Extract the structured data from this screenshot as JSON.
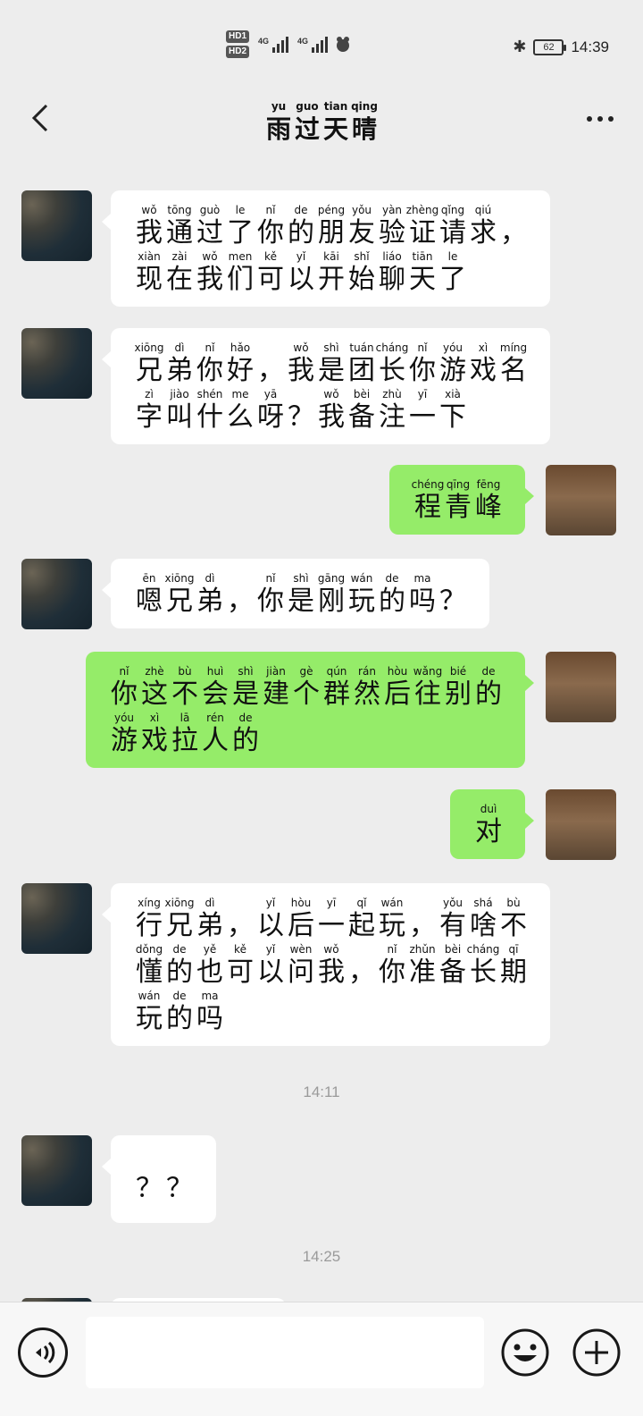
{
  "status_bar": {
    "hd1": "HD1",
    "hd2": "HD2",
    "net1": "4G",
    "net2": "4G",
    "battery": "62",
    "time": "14:39"
  },
  "header": {
    "title_chars": [
      {
        "py": "yu",
        "hz": "雨"
      },
      {
        "py": "guo",
        "hz": "过"
      },
      {
        "py": "tian",
        "hz": "天"
      },
      {
        "py": "qing",
        "hz": "晴"
      }
    ],
    "back_icon": "chevron-left-icon",
    "more_icon": "more-dots-icon"
  },
  "messages": [
    {
      "side": "left",
      "lines": [
        [
          [
            "wǒ",
            "我"
          ],
          [
            "tōng",
            "通"
          ],
          [
            "guò",
            "过"
          ],
          [
            "le",
            "了"
          ],
          [
            "nǐ",
            "你"
          ],
          [
            "de",
            "的"
          ],
          [
            "péng",
            "朋"
          ],
          [
            "yǒu",
            "友"
          ],
          [
            "yàn",
            "验"
          ],
          [
            "zhèng",
            "证"
          ],
          [
            "qǐng",
            "请"
          ],
          [
            "qiú",
            "求"
          ],
          [
            "",
            "，"
          ]
        ],
        [
          [
            "xiàn",
            "现"
          ],
          [
            "zài",
            "在"
          ],
          [
            "wǒ",
            "我"
          ],
          [
            "men",
            "们"
          ],
          [
            "kě",
            "可"
          ],
          [
            "yǐ",
            "以"
          ],
          [
            "kāi",
            "开"
          ],
          [
            "shǐ",
            "始"
          ],
          [
            "liáo",
            "聊"
          ],
          [
            "tiān",
            "天"
          ],
          [
            "le",
            "了"
          ]
        ]
      ]
    },
    {
      "side": "left",
      "lines": [
        [
          [
            "xiōng",
            "兄"
          ],
          [
            "dì",
            "弟"
          ],
          [
            "nǐ",
            "你"
          ],
          [
            "hǎo",
            "好"
          ],
          [
            "",
            "，"
          ],
          [
            "wǒ",
            "我"
          ],
          [
            "shì",
            "是"
          ],
          [
            "tuán",
            "团"
          ],
          [
            "cháng",
            "长"
          ],
          [
            "nǐ",
            "你"
          ],
          [
            "yóu",
            "游"
          ],
          [
            "xì",
            "戏"
          ],
          [
            "míng",
            "名"
          ]
        ],
        [
          [
            "zì",
            "字"
          ],
          [
            "jiào",
            "叫"
          ],
          [
            "shén",
            "什"
          ],
          [
            "me",
            "么"
          ],
          [
            "yā",
            "呀"
          ],
          [
            "",
            "？"
          ],
          [
            "wǒ",
            "我"
          ],
          [
            "bèi",
            "备"
          ],
          [
            "zhù",
            "注"
          ],
          [
            "yī",
            "一"
          ],
          [
            "xià",
            "下"
          ]
        ]
      ]
    },
    {
      "side": "right",
      "lines": [
        [
          [
            "chéng",
            "程"
          ],
          [
            "qīng",
            "青"
          ],
          [
            "fēng",
            "峰"
          ]
        ]
      ]
    },
    {
      "side": "left",
      "lines": [
        [
          [
            "ēn",
            "嗯"
          ],
          [
            "xiōng",
            "兄"
          ],
          [
            "dì",
            "弟"
          ],
          [
            "",
            "，"
          ],
          [
            "nǐ",
            "你"
          ],
          [
            "shì",
            "是"
          ],
          [
            "gāng",
            "刚"
          ],
          [
            "wán",
            "玩"
          ],
          [
            "de",
            "的"
          ],
          [
            "ma",
            "吗"
          ],
          [
            "",
            "？"
          ]
        ]
      ]
    },
    {
      "side": "right",
      "lines": [
        [
          [
            "nǐ",
            "你"
          ],
          [
            "zhè",
            "这"
          ],
          [
            "bù",
            "不"
          ],
          [
            "huì",
            "会"
          ],
          [
            "shì",
            "是"
          ],
          [
            "jiàn",
            "建"
          ],
          [
            "gè",
            "个"
          ],
          [
            "qún",
            "群"
          ],
          [
            "rán",
            "然"
          ],
          [
            "hòu",
            "后"
          ],
          [
            "wǎng",
            "往"
          ],
          [
            "bié",
            "别"
          ],
          [
            "de",
            "的"
          ]
        ],
        [
          [
            "yóu",
            "游"
          ],
          [
            "xì",
            "戏"
          ],
          [
            "lā",
            "拉"
          ],
          [
            "rén",
            "人"
          ],
          [
            "de",
            "的"
          ]
        ]
      ]
    },
    {
      "side": "right",
      "lines": [
        [
          [
            "duì",
            "对"
          ]
        ]
      ]
    },
    {
      "side": "left",
      "lines": [
        [
          [
            "xíng",
            "行"
          ],
          [
            "xiōng",
            "兄"
          ],
          [
            "dì",
            "弟"
          ],
          [
            "",
            "，"
          ],
          [
            "yǐ",
            "以"
          ],
          [
            "hòu",
            "后"
          ],
          [
            "yī",
            "一"
          ],
          [
            "qǐ",
            "起"
          ],
          [
            "wán",
            "玩"
          ],
          [
            "",
            "，"
          ],
          [
            "yǒu",
            "有"
          ],
          [
            "shá",
            "啥"
          ],
          [
            "bù",
            "不"
          ]
        ],
        [
          [
            "dǒng",
            "懂"
          ],
          [
            "de",
            "的"
          ],
          [
            "yě",
            "也"
          ],
          [
            "kě",
            "可"
          ],
          [
            "yǐ",
            "以"
          ],
          [
            "wèn",
            "问"
          ],
          [
            "wǒ",
            "我"
          ],
          [
            "",
            "，"
          ],
          [
            "nǐ",
            "你"
          ],
          [
            "zhǔn",
            "准"
          ],
          [
            "bèi",
            "备"
          ],
          [
            "cháng",
            "长"
          ],
          [
            "qī",
            "期"
          ]
        ],
        [
          [
            "wán",
            "玩"
          ],
          [
            "de",
            "的"
          ],
          [
            "ma",
            "吗"
          ]
        ]
      ]
    },
    {
      "side": "left",
      "lines": [
        [
          [
            "",
            "？"
          ],
          [
            "",
            "？"
          ]
        ]
      ]
    }
  ],
  "timestamps": [
    "14:11",
    "14:25"
  ],
  "input_bar": {
    "voice_icon": "voice-icon",
    "emoji_icon": "emoji-icon",
    "plus_icon": "plus-icon",
    "placeholder": ""
  }
}
